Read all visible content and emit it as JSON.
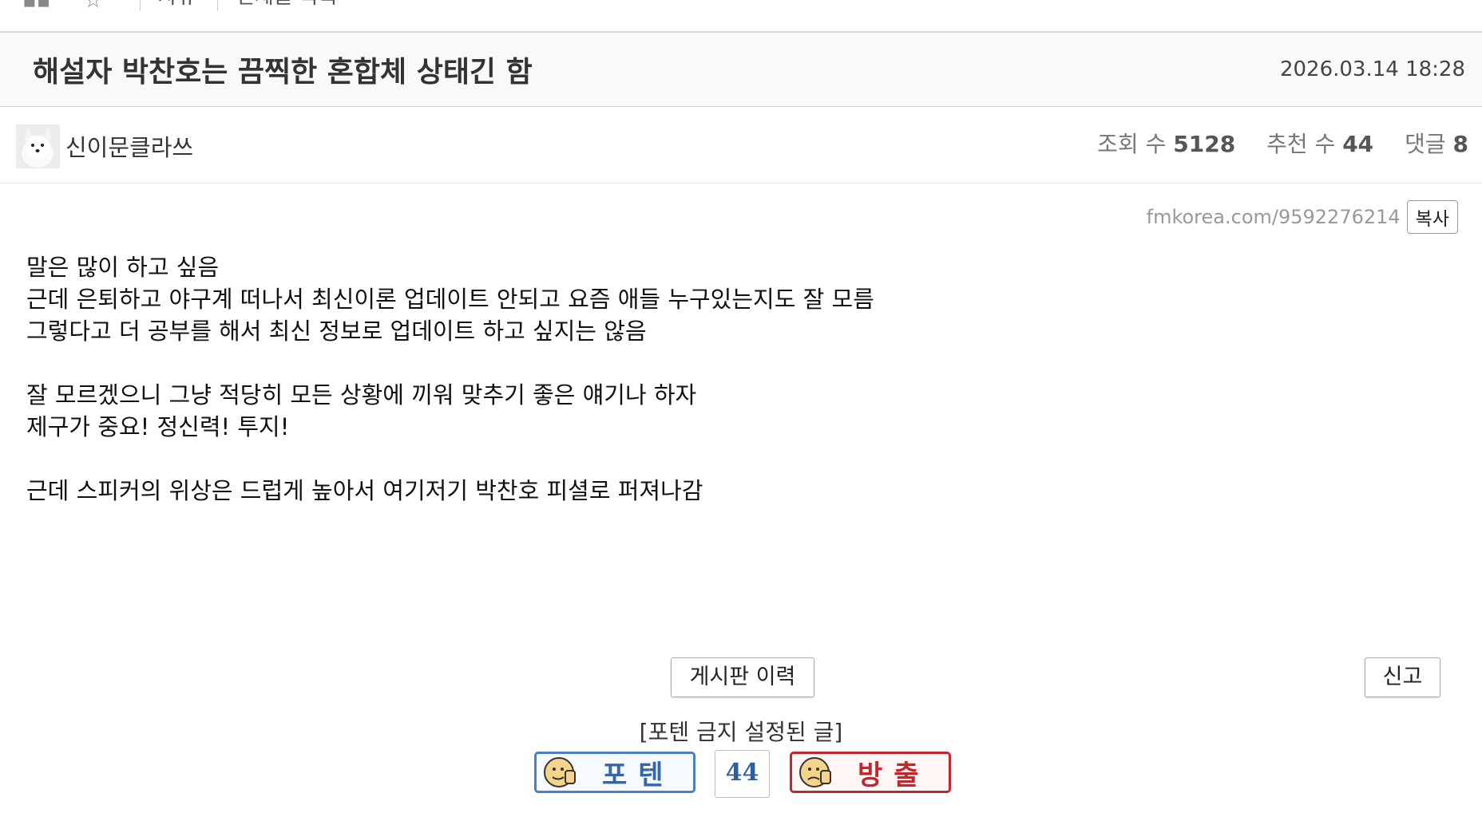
{
  "topbar": {
    "tab1": "자유",
    "tab2": "전체글 목록"
  },
  "post": {
    "title": "해설자 박찬호는 끔찍한 혼합체 상태긴 함",
    "date": "2026.03.14 18:28",
    "author": "신이문클라쓰",
    "stats": {
      "views_label": "조회 수",
      "views": "5128",
      "recommend_label": "추천 수",
      "recommend": "44",
      "comments_label": "댓글",
      "comments": "8"
    },
    "url": "fmkorea.com/9592276214",
    "copy_label": "복사",
    "body": [
      "말은 많이 하고 싶음",
      "근데 은퇴하고 야구계 떠나서 최신이론 업데이트 안되고 요즘 애들 누구있는지도 잘 모름",
      "그렇다고 더 공부를 해서 최신 정보로 업데이트 하고 싶지는 않음",
      "",
      "잘 모르겠으니 그냥 적당히 모든 상황에 끼워 맞추기 좋은 얘기나 하자",
      "제구가 중요! 정신력! 투지!",
      "",
      "근데 스피커의 위상은 드럽게 높아서 여기저기 박찬호 피셜로 퍼져나감"
    ]
  },
  "actions": {
    "board_history": "게시판 이력",
    "report": "신고",
    "notice": "[포텐 금지 설정된 글]",
    "vote_up": "포텐",
    "vote_count": "44",
    "vote_down": "방출"
  }
}
